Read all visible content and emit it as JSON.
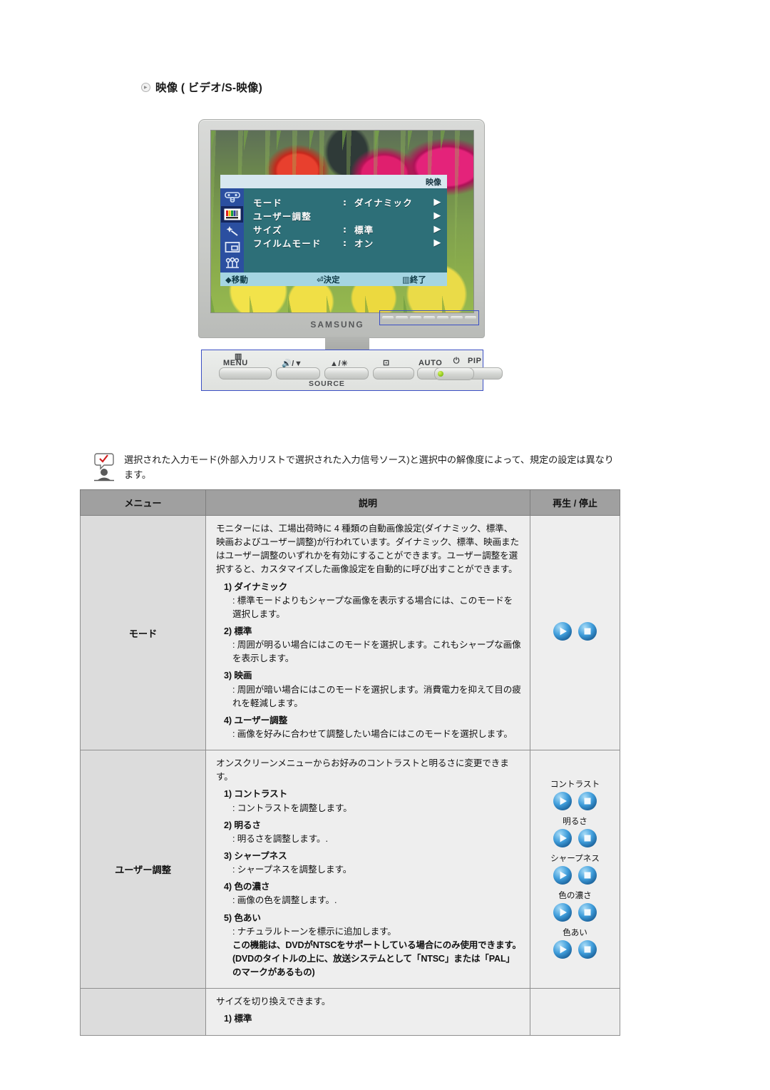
{
  "heading": {
    "icon": "arrow-bullet-icon",
    "text": "映像 ( ビデオ/S-映像)"
  },
  "monitor": {
    "brand": "SAMSUNG",
    "osd": {
      "title": "映像",
      "rows": [
        {
          "label": "モード",
          "colon": ":",
          "value": "ダイナミック",
          "arrow": "▶"
        },
        {
          "label": "ユーザー調整",
          "colon": "",
          "value": "",
          "arrow": "▶"
        },
        {
          "label": "サイズ",
          "colon": ":",
          "value": "標準",
          "arrow": "▶"
        },
        {
          "label": "フイルムモード",
          "colon": ":",
          "value": "オン",
          "arrow": "▶"
        }
      ],
      "icons": [
        "osd-input-icon",
        "osd-picture-icon",
        "osd-magic-icon",
        "osd-pip-icon",
        "osd-setup-icon"
      ],
      "footer": {
        "move": "移動",
        "enter": "決定",
        "exit": "終了"
      }
    },
    "controls": {
      "buttons": [
        {
          "name": "menu-button",
          "label": "MENU"
        },
        {
          "name": "down-volume-button",
          "label": "/▼"
        },
        {
          "name": "up-brightness-button",
          "label": "▲/"
        },
        {
          "name": "source-enter-button",
          "label": ""
        },
        {
          "name": "auto-button",
          "label": "AUTO"
        },
        {
          "name": "pip-button",
          "label": "PIP"
        }
      ],
      "source_label": "SOURCE",
      "power_label": "power-button"
    }
  },
  "note": {
    "icon": "note-person-icon",
    "text": "選択された入力モード(外部入力リストで選択された入力信号ソース)と選択中の解像度によって、規定の設定は異なります。"
  },
  "table": {
    "headers": {
      "menu": "メニュー",
      "description": "説明",
      "control": "再生 / 停止"
    },
    "rows": [
      {
        "menu": "モード",
        "intro": "モニターには、工場出荷時に 4 種類の自動画像設定(ダイナミック、標準、映画およびユーザー調整)が行われています。ダイナミック、標準、映画またはユーザー調整のいずれかを有効にすることができます。ユーザー調整を選択すると、カスタマイズした画像設定を自動的に呼び出すことができます。",
        "items": [
          {
            "title": "1) ダイナミック",
            "body": ": 標準モードよりもシャープな画像を表示する場合には、このモードを選択します。"
          },
          {
            "title": "2) 標準",
            "body": ": 周囲が明るい場合にはこのモードを選択します。これもシャープな画像を表示します。"
          },
          {
            "title": "3) 映画",
            "body": ": 周囲が暗い場合にはこのモードを選択します。消費電力を抑えて目の疲れを軽減します。"
          },
          {
            "title": "4) ユーザー調整",
            "body": ": 画像を好みに合わせて調整したい場合にはこのモードを選択します。"
          }
        ],
        "controls": [
          {
            "label": "",
            "buttons": [
              "play-button",
              "stop-button"
            ]
          }
        ]
      },
      {
        "menu": "ユーザー調整",
        "intro": "オンスクリーンメニューからお好みのコントラストと明るさに変更できます。",
        "items": [
          {
            "title": "1) コントラスト",
            "body": ": コントラストを調整します。"
          },
          {
            "title": "2) 明るさ",
            "body": ": 明るさを調整します。."
          },
          {
            "title": "3) シャープネス",
            "body": ": シャープネスを調整します。"
          },
          {
            "title": "4) 色の濃さ",
            "body": ": 画像の色を調整します。."
          },
          {
            "title": "5) 色あい",
            "body": ": ナチュラルトーンを標示に追加します。"
          }
        ],
        "footnote": "この機能は、DVDがNTSCをサポートしている場合にのみ使用できます。(DVDのタイトルの上に、放送システムとして「NTSC」または「PAL」のマークがあるもの)",
        "controls": [
          {
            "label": "コントラスト",
            "buttons": [
              "play-button",
              "stop-button"
            ]
          },
          {
            "label": "明るさ",
            "buttons": [
              "play-button",
              "stop-button"
            ]
          },
          {
            "label": "シャープネス",
            "buttons": [
              "play-button",
              "stop-button"
            ]
          },
          {
            "label": "色の濃さ",
            "buttons": [
              "play-button",
              "stop-button"
            ]
          },
          {
            "label": "色あい",
            "buttons": [
              "play-button",
              "stop-button"
            ]
          }
        ]
      },
      {
        "menu": "",
        "intro": "サイズを切り換えできます。",
        "items": [
          {
            "title": "1) 標準",
            "body": ""
          }
        ],
        "controls": []
      }
    ]
  },
  "colors": {
    "osd_panel": "#2d6f78",
    "osd_sidebar": "#2b4fa0",
    "osd_titlebar": "#d7e7ef",
    "osd_footer": "#a5d5e2",
    "table_header": "#a0a0a0",
    "menu_cell": "#dcdcdc",
    "desc_cell": "#eeeeee",
    "highlight_border": "#3b4fc4"
  }
}
